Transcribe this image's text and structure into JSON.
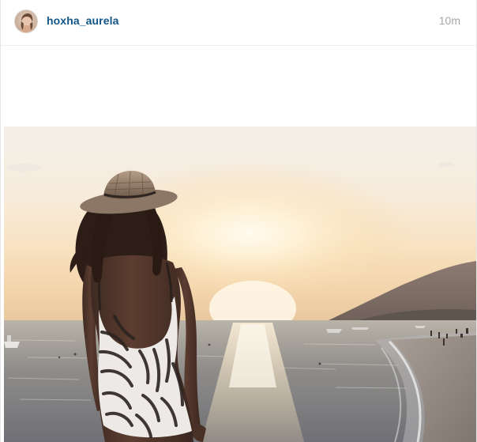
{
  "post": {
    "username": "hoxha_aurela",
    "timestamp": "10m",
    "avatar_icon": "profile-avatar",
    "photo": {
      "subject": "beach-sunset-photo"
    }
  },
  "colors": {
    "username": "#125688",
    "timestamp": "#a5a7aa",
    "divider": "#efefef"
  }
}
